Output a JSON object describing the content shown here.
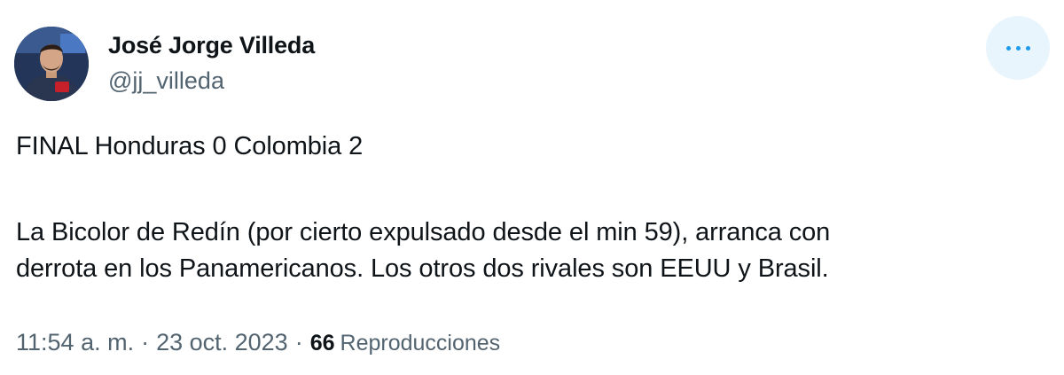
{
  "author": {
    "name": "José Jorge Villeda",
    "handle": "@jj_villeda"
  },
  "more_menu": {
    "icon": "more-horizontal-icon",
    "color": "#1d9bf0"
  },
  "tweet": {
    "line1": "FINAL Honduras 0 Colombia 2",
    "line2": "La Bicolor de Redín (por cierto expulsado desde el min 59), arranca con",
    "line3": "derrota en los Panamericanos. Los otros dos rivales son EEUU y Brasil."
  },
  "meta": {
    "time": "11:54 a. m.",
    "separator": "·",
    "date": "23 oct. 2023",
    "views_count": "66",
    "views_label": "Reproducciones"
  }
}
